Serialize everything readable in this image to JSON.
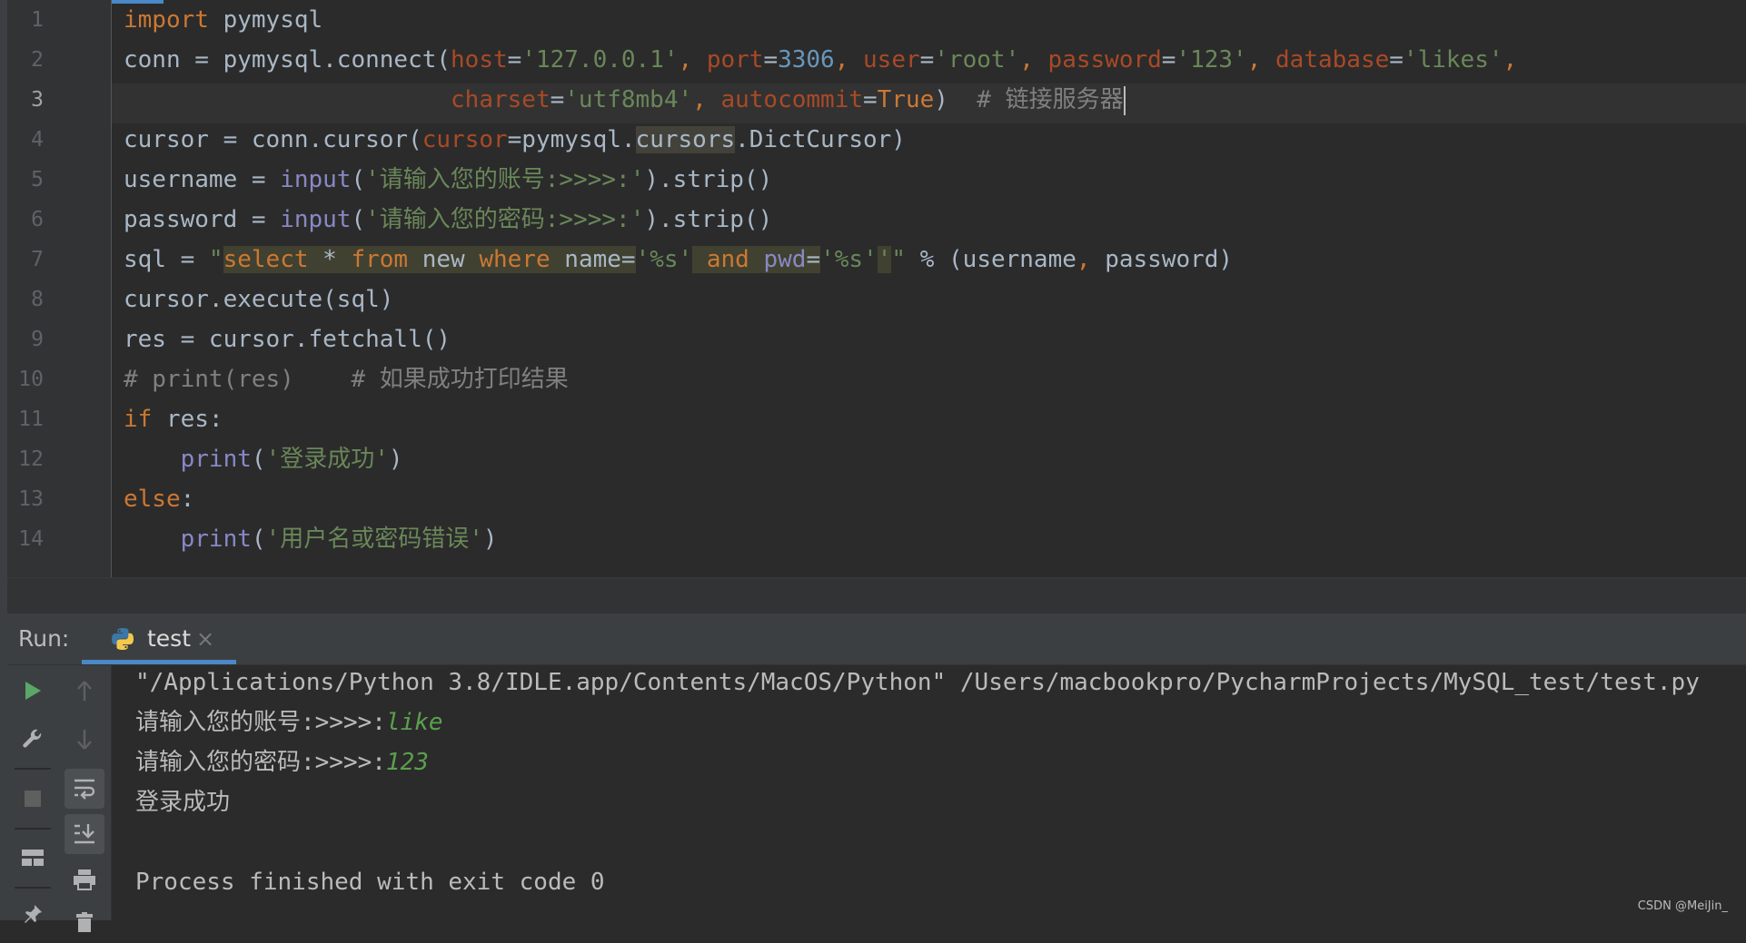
{
  "editor": {
    "line_numbers": [
      "1",
      "2",
      "3",
      "4",
      "5",
      "6",
      "7",
      "8",
      "9",
      "10",
      "11",
      "12",
      "13",
      "14"
    ],
    "current_line": "3",
    "lines": [
      [
        {
          "t": "import",
          "c": "kw"
        },
        {
          "t": " pymysql"
        }
      ],
      [
        {
          "t": "conn = pymysql.connect("
        },
        {
          "t": "host",
          "c": "param"
        },
        {
          "t": "="
        },
        {
          "t": "'127.0.0.1'",
          "c": "str"
        },
        {
          "t": ", ",
          "c": "kw"
        },
        {
          "t": "port",
          "c": "param"
        },
        {
          "t": "="
        },
        {
          "t": "3306",
          "c": "num"
        },
        {
          "t": ", ",
          "c": "kw"
        },
        {
          "t": "user",
          "c": "param"
        },
        {
          "t": "="
        },
        {
          "t": "'root'",
          "c": "str"
        },
        {
          "t": ", ",
          "c": "kw"
        },
        {
          "t": "password",
          "c": "param"
        },
        {
          "t": "="
        },
        {
          "t": "'123'",
          "c": "str"
        },
        {
          "t": ", ",
          "c": "kw"
        },
        {
          "t": "database",
          "c": "param"
        },
        {
          "t": "="
        },
        {
          "t": "'likes'",
          "c": "str"
        },
        {
          "t": ",",
          "c": "kw"
        }
      ],
      [
        {
          "t": "                       "
        },
        {
          "t": "charset",
          "c": "param"
        },
        {
          "t": "="
        },
        {
          "t": "'utf8mb4'",
          "c": "str"
        },
        {
          "t": ", ",
          "c": "kw"
        },
        {
          "t": "autocommit",
          "c": "param"
        },
        {
          "t": "="
        },
        {
          "t": "True",
          "c": "kw"
        },
        {
          "t": ")  "
        },
        {
          "t": "# 链接服务器",
          "c": "cmt"
        }
      ],
      [
        {
          "t": "cursor = conn.cursor("
        },
        {
          "t": "cursor",
          "c": "param"
        },
        {
          "t": "=pymysql."
        },
        {
          "t": "cursors",
          "c": "hl"
        },
        {
          "t": ".DictCursor)"
        }
      ],
      [
        {
          "t": "username = "
        },
        {
          "t": "input",
          "c": "builtin"
        },
        {
          "t": "("
        },
        {
          "t": "'请输入您的账号:>>>>:'",
          "c": "str"
        },
        {
          "t": ").strip()"
        }
      ],
      [
        {
          "t": "password = "
        },
        {
          "t": "input",
          "c": "builtin"
        },
        {
          "t": "("
        },
        {
          "t": "'请输入您的密码:>>>>:'",
          "c": "str"
        },
        {
          "t": ").strip()"
        }
      ],
      [
        {
          "t": "sql = "
        },
        {
          "t": "\"",
          "c": "str"
        },
        {
          "t": "select",
          "c": "sqlkw sqlbg"
        },
        {
          "t": " ",
          "c": "sqlbg"
        },
        {
          "t": "*",
          "c": "sqlbg"
        },
        {
          "t": " ",
          "c": "sqlbg"
        },
        {
          "t": "from",
          "c": "sqlkw sqlbg"
        },
        {
          "t": " new ",
          "c": "sqlbg"
        },
        {
          "t": "where",
          "c": "sqlkw sqlbg"
        },
        {
          "t": " name=",
          "c": "sqlbg"
        },
        {
          "t": "'%s'",
          "c": "str"
        },
        {
          "t": " ",
          "c": "sqlbg"
        },
        {
          "t": "and",
          "c": "sqlkw sqlbg"
        },
        {
          "t": " ",
          "c": "sqlbg"
        },
        {
          "t": "pwd",
          "c": "builtin sqlbg"
        },
        {
          "t": "=",
          "c": "sqlbg"
        },
        {
          "t": "'%s'",
          "c": "str"
        },
        {
          "t": "'",
          "c": "sqlbg str"
        },
        {
          "t": "\"",
          "c": "str"
        },
        {
          "t": " % (username"
        },
        {
          "t": ", ",
          "c": "kw"
        },
        {
          "t": "password)"
        }
      ],
      [
        {
          "t": "cursor.execute(sql)"
        }
      ],
      [
        {
          "t": "res = cursor.fetchall()"
        }
      ],
      [
        {
          "t": "# print(res)    # 如果成功打印结果",
          "c": "cmt"
        }
      ],
      [
        {
          "t": "if",
          "c": "kw"
        },
        {
          "t": " res:"
        }
      ],
      [
        {
          "t": "    "
        },
        {
          "t": "print",
          "c": "builtin"
        },
        {
          "t": "("
        },
        {
          "t": "'登录成功'",
          "c": "str"
        },
        {
          "t": ")"
        }
      ],
      [
        {
          "t": "else",
          "c": "kw"
        },
        {
          "t": ":"
        }
      ],
      [
        {
          "t": "    "
        },
        {
          "t": "print",
          "c": "builtin"
        },
        {
          "t": "("
        },
        {
          "t": "'用户名或密码错误'",
          "c": "str"
        },
        {
          "t": ")"
        }
      ]
    ]
  },
  "run": {
    "label": "Run:",
    "tab_label": "test",
    "tab_close": "×",
    "tab_icon": "python-icon",
    "toolbar_icons": [
      "run-icon",
      "up-arrow-icon",
      "wrench-icon",
      "down-arrow-icon",
      "stop-icon",
      "soft-wrap-icon",
      "scroll-to-end-icon",
      "layout-icon",
      "print-icon",
      "pin-icon",
      "trash-icon"
    ]
  },
  "console": {
    "command": "\"/Applications/Python 3.8/IDLE.app/Contents/MacOS/Python\" /Users/macbookpro/PycharmProjects/MySQL_test/test.py",
    "prompt_user": "请输入您的账号:>>>>:",
    "input_user": "like",
    "prompt_pwd": "请输入您的密码:>>>>:",
    "input_pwd": "123",
    "result": "登录成功",
    "exit_msg": "Process finished with exit code 0"
  },
  "watermark": "CSDN @MeiJin_"
}
